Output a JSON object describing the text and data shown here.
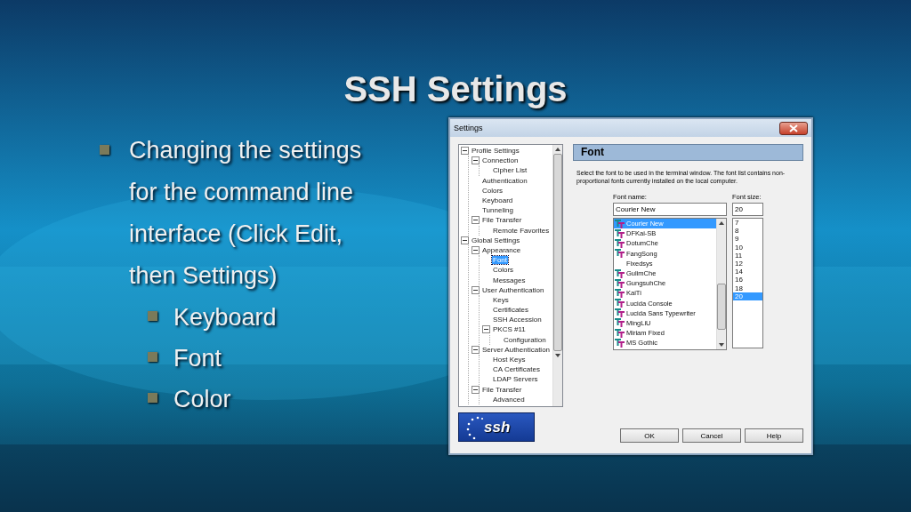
{
  "slide": {
    "title": "SSH Settings",
    "bullets": [
      {
        "text": "Changing the settings for the command line interface (Click Edit, then Settings)",
        "children": [
          {
            "text": "Keyboard"
          },
          {
            "text": "Font"
          },
          {
            "text": "Color"
          }
        ]
      }
    ]
  },
  "dialog": {
    "title": "Settings",
    "tree": [
      {
        "label": "Profile Settings",
        "expanded": true,
        "selected": false,
        "children": [
          {
            "label": "Connection",
            "expanded": true,
            "selected": false,
            "children": [
              {
                "label": "Cipher List",
                "selected": false
              }
            ]
          },
          {
            "label": "Authentication",
            "selected": false
          },
          {
            "label": "Colors",
            "selected": false
          },
          {
            "label": "Keyboard",
            "selected": false
          },
          {
            "label": "Tunneling",
            "selected": false
          },
          {
            "label": "File Transfer",
            "expanded": true,
            "selected": false,
            "children": [
              {
                "label": "Remote Favorites",
                "selected": false
              }
            ]
          }
        ]
      },
      {
        "label": "Global Settings",
        "expanded": true,
        "selected": false,
        "children": [
          {
            "label": "Appearance",
            "expanded": true,
            "selected": false,
            "children": [
              {
                "label": "Font",
                "selected": true
              },
              {
                "label": "Colors",
                "selected": false
              },
              {
                "label": "Messages",
                "selected": false
              }
            ]
          },
          {
            "label": "User Authentication",
            "expanded": true,
            "selected": false,
            "children": [
              {
                "label": "Keys",
                "selected": false
              },
              {
                "label": "Certificates",
                "selected": false
              },
              {
                "label": "SSH Accession",
                "selected": false
              },
              {
                "label": "PKCS #11",
                "expanded": true,
                "selected": false,
                "children": [
                  {
                    "label": "Configuration",
                    "selected": false
                  }
                ]
              }
            ]
          },
          {
            "label": "Server Authentication",
            "expanded": true,
            "selected": false,
            "children": [
              {
                "label": "Host Keys",
                "selected": false
              },
              {
                "label": "CA Certificates",
                "selected": false
              },
              {
                "label": "LDAP Servers",
                "selected": false
              }
            ]
          },
          {
            "label": "File Transfer",
            "expanded": true,
            "selected": false,
            "children": [
              {
                "label": "Advanced",
                "selected": false
              }
            ]
          }
        ]
      }
    ],
    "logo": "ssh",
    "panel_title": "Font",
    "description": "Select the font to be used in the terminal window.  The font list contains non-proportional fonts currently installed on the local computer.",
    "font_name": {
      "label": "Font name:",
      "value": "Courier New",
      "options": [
        {
          "label": "Courier New",
          "kind": "truetype",
          "selected": true
        },
        {
          "label": "DFKai-SB",
          "kind": "truetype",
          "selected": false
        },
        {
          "label": "DotumChe",
          "kind": "truetype",
          "selected": false
        },
        {
          "label": "FangSong",
          "kind": "truetype",
          "selected": false
        },
        {
          "label": "Fixedsys",
          "kind": "plain",
          "selected": false
        },
        {
          "label": "GulimChe",
          "kind": "truetype",
          "selected": false
        },
        {
          "label": "GungsuhChe",
          "kind": "truetype",
          "selected": false
        },
        {
          "label": "KaiTi",
          "kind": "truetype",
          "selected": false
        },
        {
          "label": "Lucida Console",
          "kind": "truetype",
          "selected": false
        },
        {
          "label": "Lucida Sans Typewriter",
          "kind": "truetype",
          "selected": false
        },
        {
          "label": "MingLiU",
          "kind": "truetype",
          "selected": false
        },
        {
          "label": "Miriam Fixed",
          "kind": "truetype",
          "selected": false
        },
        {
          "label": "MS Gothic",
          "kind": "truetype",
          "selected": false
        }
      ]
    },
    "font_size": {
      "label": "Font size:",
      "value": "20",
      "options": [
        {
          "label": "7",
          "selected": false
        },
        {
          "label": "8",
          "selected": false
        },
        {
          "label": "9",
          "selected": false
        },
        {
          "label": "10",
          "selected": false
        },
        {
          "label": "11",
          "selected": false
        },
        {
          "label": "12",
          "selected": false
        },
        {
          "label": "14",
          "selected": false
        },
        {
          "label": "16",
          "selected": false
        },
        {
          "label": "18",
          "selected": false
        },
        {
          "label": "20",
          "selected": true
        }
      ]
    },
    "buttons": [
      "OK",
      "Cancel",
      "Help"
    ]
  }
}
